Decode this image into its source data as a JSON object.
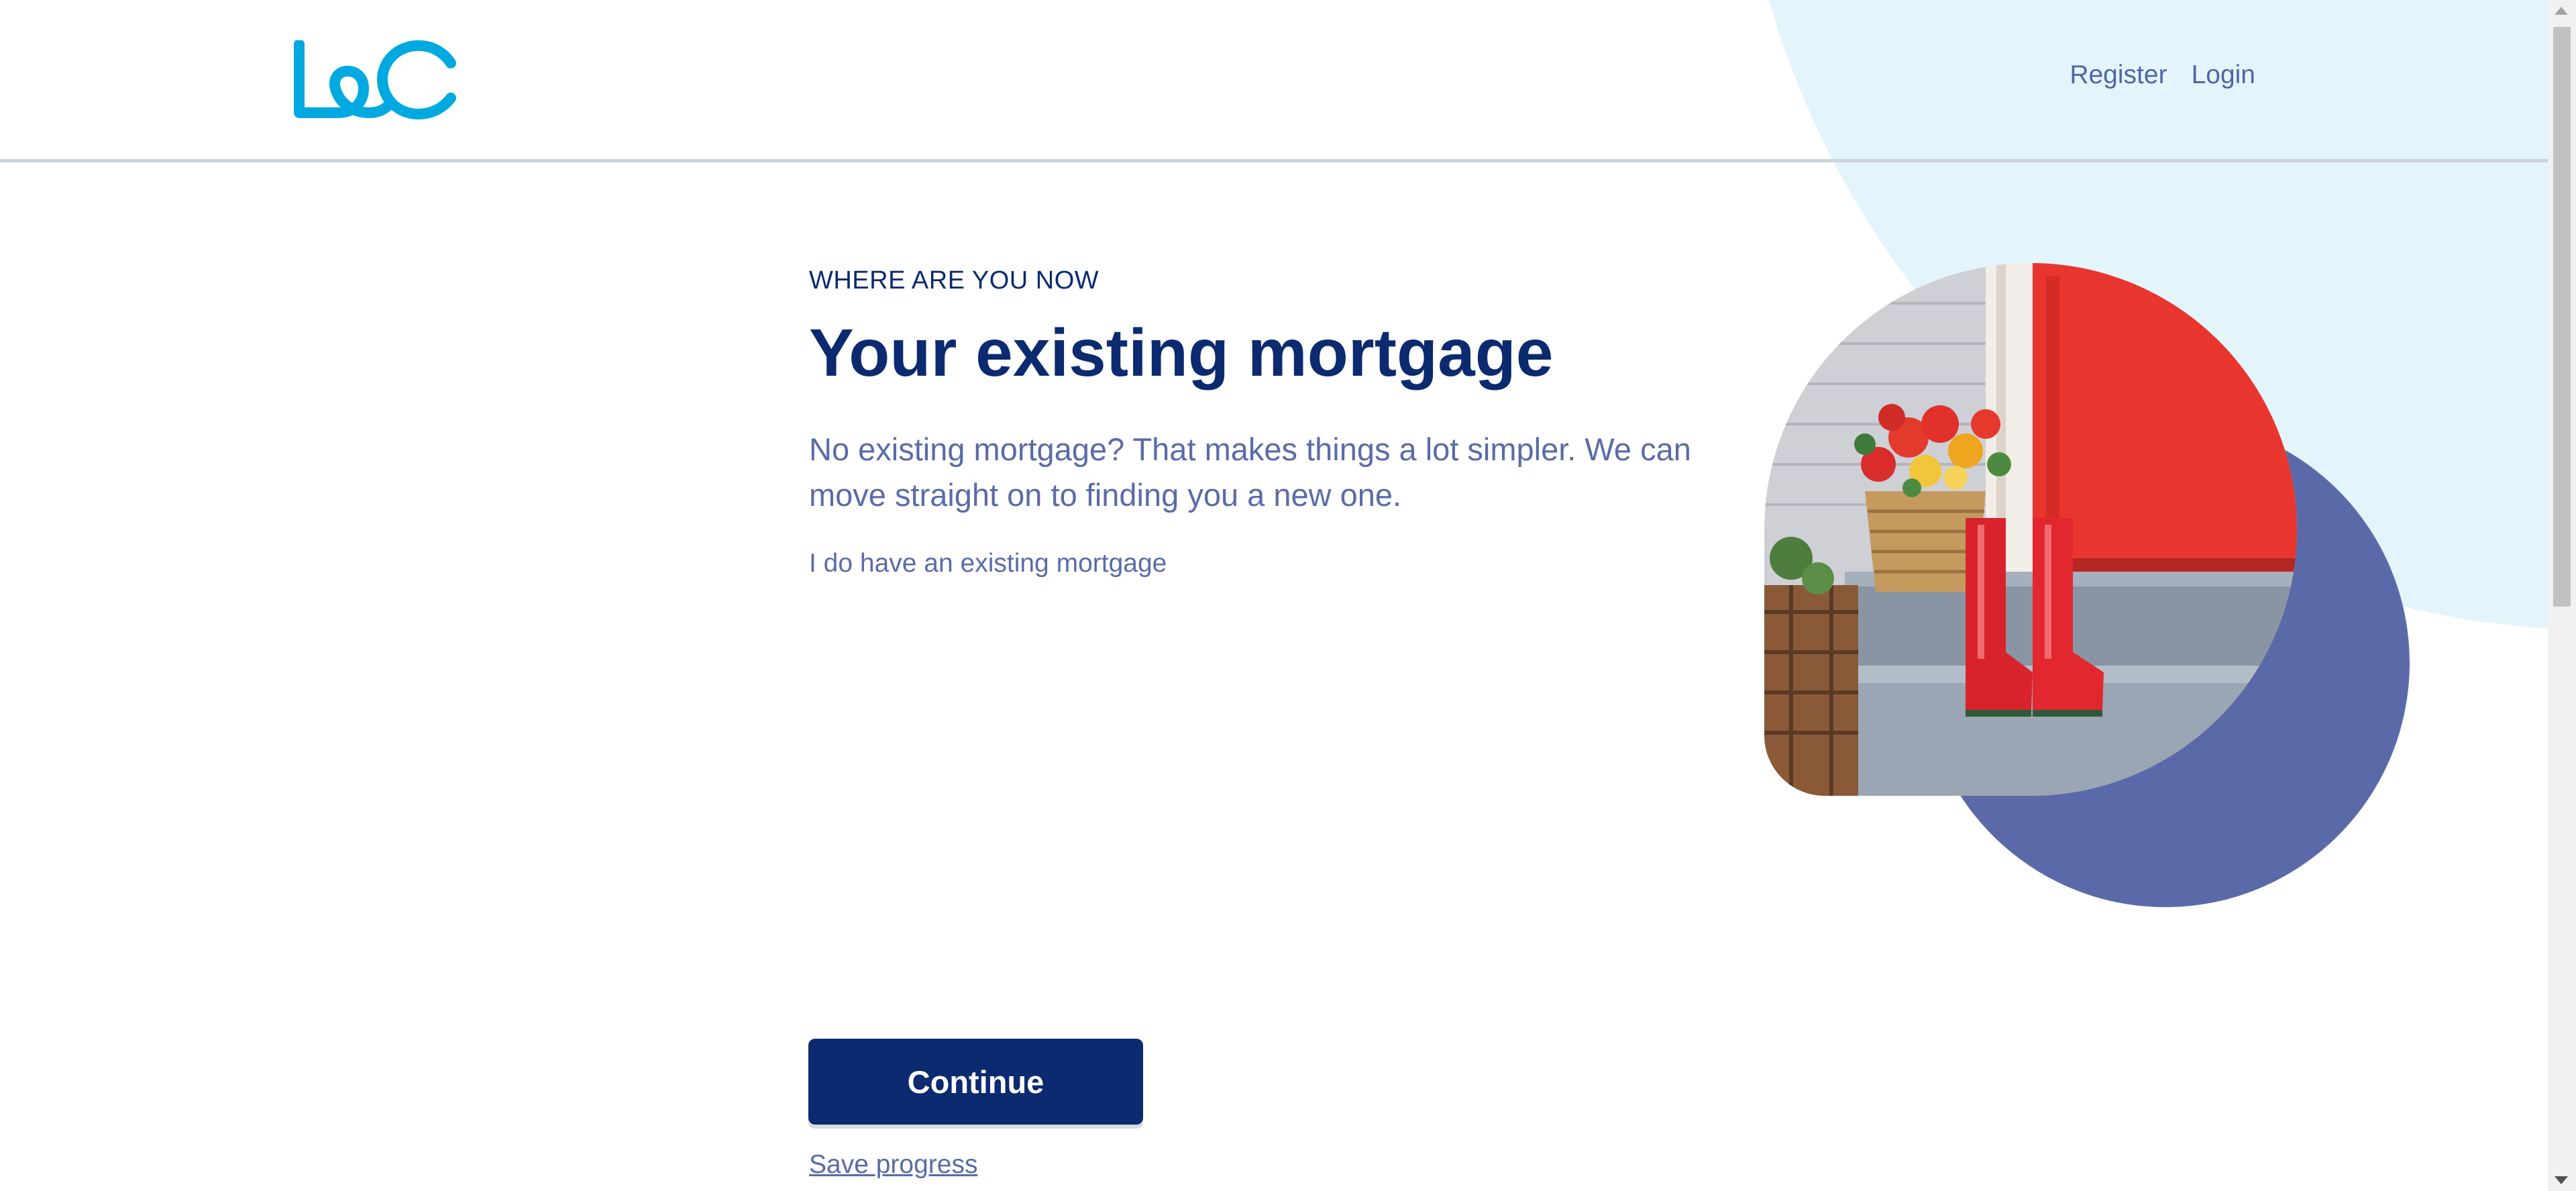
{
  "header": {
    "logo_text": "L&C",
    "nav": {
      "register": "Register",
      "login": "Login"
    }
  },
  "main": {
    "eyebrow": "WHERE ARE YOU NOW",
    "title": "Your existing mortgage",
    "lead": "No existing mortgage? That makes things a lot simpler. We can move straight on to finding you a new one.",
    "existing_link": "I do have an existing mortgage"
  },
  "actions": {
    "continue_label": "Continue",
    "save_label": "Save progress"
  },
  "theme": {
    "brand_navy": "#0b2a6f",
    "brand_cyan": "#00a9e0",
    "text_muted": "#5a6ba7",
    "accent_purple": "#5a6aa9",
    "background_tint": "#e4f4fb"
  },
  "icons": {
    "logo": "lc-logo",
    "photo": "red-boots-and-flower-basket-on-porch"
  }
}
